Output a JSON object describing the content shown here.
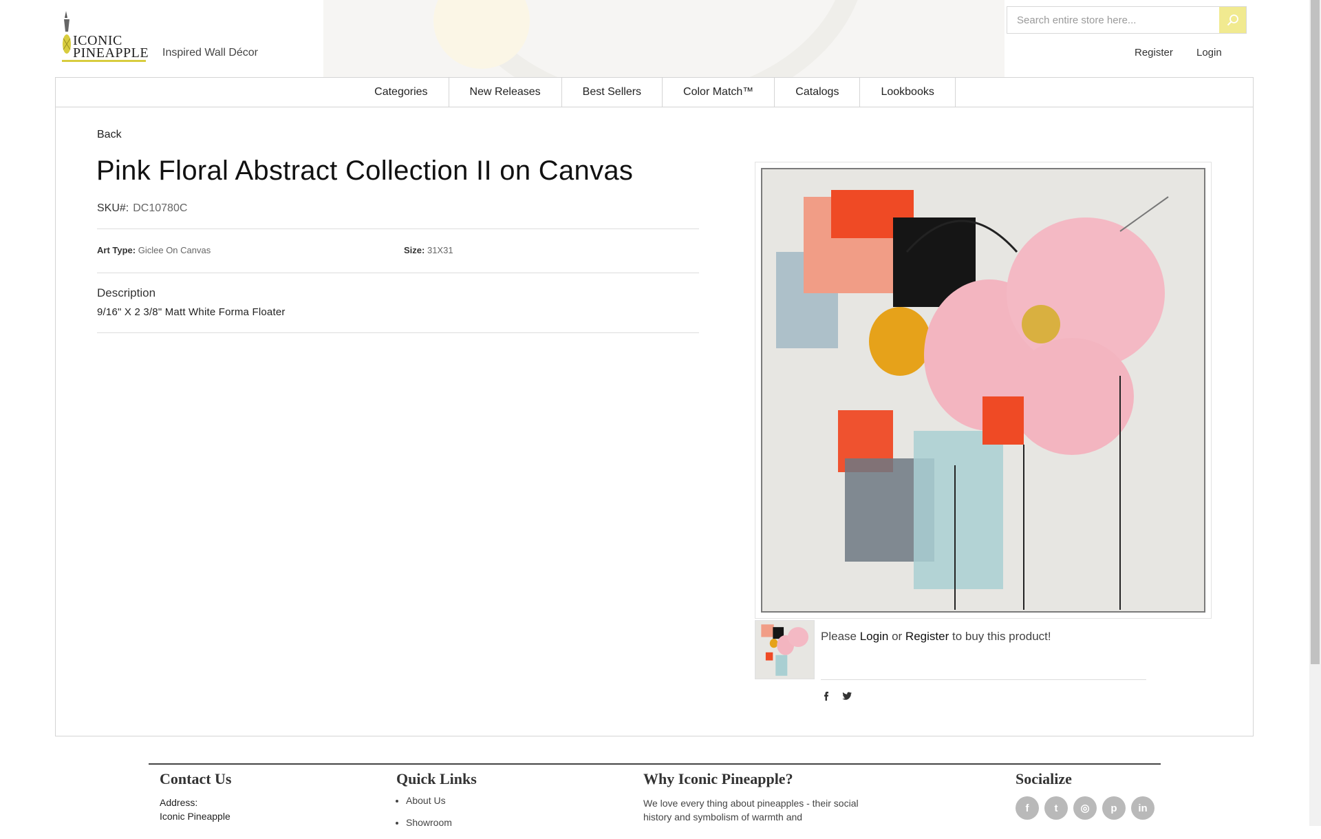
{
  "brand": {
    "logo_line1": "ICONIC",
    "logo_line2": "PINEAPPLE",
    "tagline": "Inspired Wall Décor",
    "accent_color": "#d8cc3e"
  },
  "header": {
    "search_placeholder": "Search entire store here...",
    "search_icon": "search-icon",
    "register_label": "Register",
    "login_label": "Login"
  },
  "nav": {
    "items": [
      {
        "label": "Categories"
      },
      {
        "label": "New Releases"
      },
      {
        "label": "Best Sellers"
      },
      {
        "label": "Color Match™"
      },
      {
        "label": "Catalogs"
      },
      {
        "label": "Lookbooks"
      }
    ]
  },
  "product": {
    "back_label": "Back",
    "title": "Pink Floral Abstract Collection II on Canvas",
    "sku_label": "SKU#:",
    "sku_value": "DC10780C",
    "art_type_label": "Art Type:",
    "art_type_value": "Giclee On Canvas",
    "size_label": "Size:",
    "size_value": "31X31",
    "description_heading": "Description",
    "description_text": "9/16\" X 2 3/8\" Matt White Forma Floater",
    "buy_prefix": "Please",
    "buy_login": "Login",
    "buy_or": "or",
    "buy_register": "Register",
    "buy_suffix": "to buy this product!",
    "share_icons": [
      "facebook-icon",
      "twitter-icon"
    ]
  },
  "footer": {
    "contact_heading": "Contact Us",
    "address_label": "Address:",
    "address_line1": "Iconic Pineapple",
    "quick_links_heading": "Quick Links",
    "quick_links": [
      "About Us",
      "Showroom"
    ],
    "why_heading": "Why Iconic Pineapple?",
    "why_text": "We love every thing about pineapples - their social history and symbolism of warmth and",
    "socialize_heading": "Socialize",
    "social_icons": [
      {
        "name": "facebook-icon",
        "glyph": "f"
      },
      {
        "name": "twitter-icon",
        "glyph": "t"
      },
      {
        "name": "instagram-icon",
        "glyph": "◎"
      },
      {
        "name": "pinterest-icon",
        "glyph": "p"
      },
      {
        "name": "linkedin-icon",
        "glyph": "in"
      }
    ]
  }
}
